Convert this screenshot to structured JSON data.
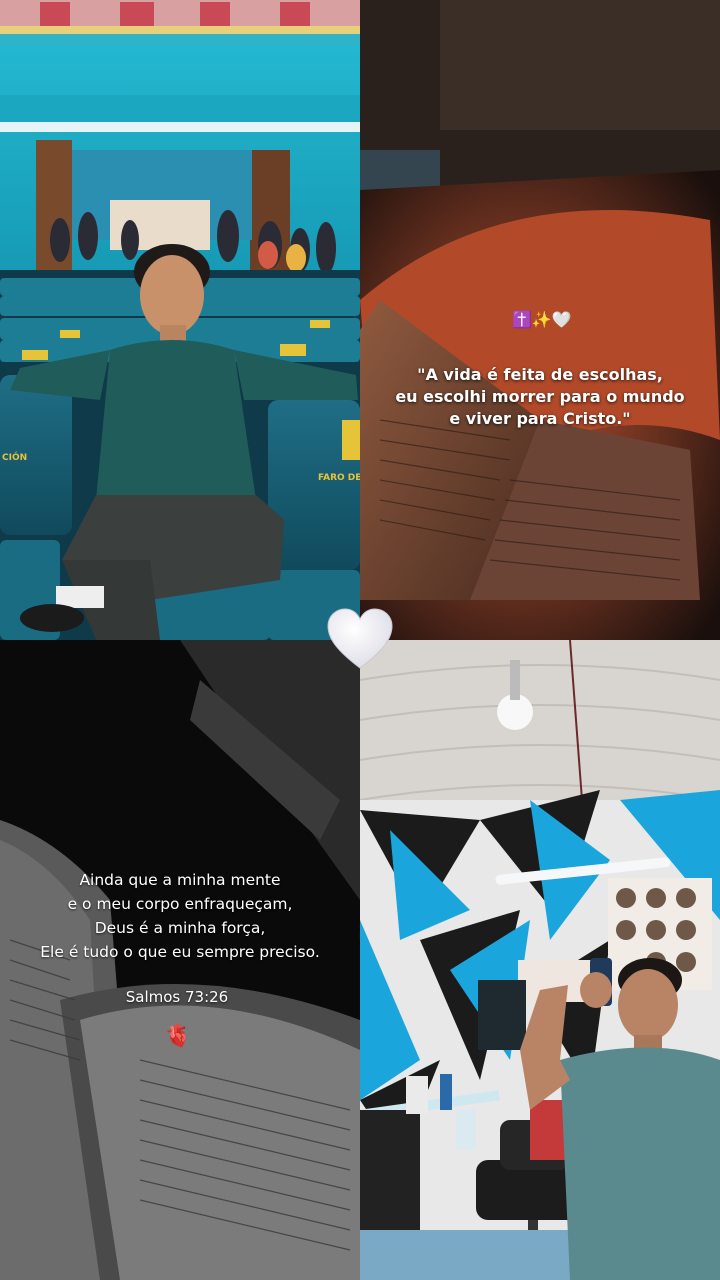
{
  "collage": {
    "top_right": {
      "emojis": "✝️✨🤍",
      "quote_lines": [
        "\"A vida é feita de escolhas,",
        "eu escolhi morrer para o mundo",
        "e viver para Cristo.\""
      ]
    },
    "bottom_left": {
      "verse_lines": [
        "Ainda que a minha mente",
        "e o meu corpo enfraqueçam,",
        "Deus é a minha força,",
        "Ele é tudo o que eu sempre preciso."
      ],
      "reference": "Salmos 73:26",
      "emoji": "🫀"
    },
    "top_left": {
      "seat_text_left": "CIÓN",
      "seat_text_right": "FARO DE"
    }
  }
}
